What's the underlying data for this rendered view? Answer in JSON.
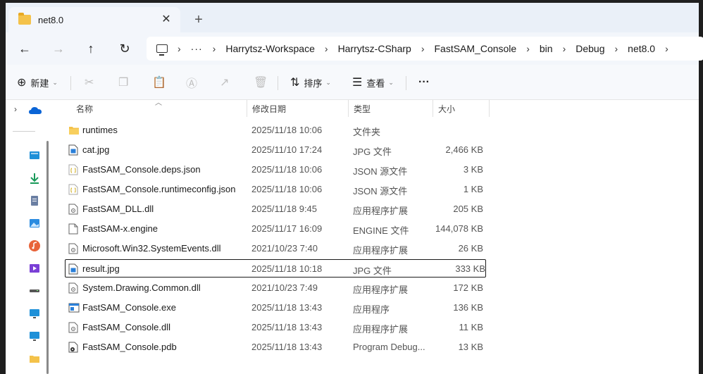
{
  "window": {
    "tab_title": "net8.0",
    "close_glyph": "✕",
    "new_tab_glyph": "+"
  },
  "nav": {
    "back_glyph": "←",
    "forward_glyph": "→",
    "up_glyph": "↑",
    "refresh_glyph": "↻",
    "overflow": "···",
    "breadcrumbs": [
      "Harrytsz-Workspace",
      "Harrytsz-CSharp",
      "FastSAM_Console",
      "bin",
      "Debug",
      "net8.0"
    ],
    "chevron": "›"
  },
  "toolbar": {
    "new_label": "新建",
    "sort_label": "排序",
    "view_label": "查看",
    "more_glyph": "···",
    "caret": "⌄"
  },
  "columns": {
    "name": "名称",
    "date": "修改日期",
    "type": "类型",
    "size": "大小"
  },
  "files": [
    {
      "name": "runtimes",
      "date": "2025/11/18 10:06",
      "type": "文件夹",
      "size": "",
      "icon": "folder-icon"
    },
    {
      "name": "cat.jpg",
      "date": "2025/11/10 17:24",
      "type": "JPG 文件",
      "size": "2,466 KB",
      "icon": "image-file-icon"
    },
    {
      "name": "FastSAM_Console.deps.json",
      "date": "2025/11/18 10:06",
      "type": "JSON 源文件",
      "size": "3 KB",
      "icon": "json-file-icon"
    },
    {
      "name": "FastSAM_Console.runtimeconfig.json",
      "date": "2025/11/18 10:06",
      "type": "JSON 源文件",
      "size": "1 KB",
      "icon": "json-file-icon"
    },
    {
      "name": "FastSAM_DLL.dll",
      "date": "2025/11/18 9:45",
      "type": "应用程序扩展",
      "size": "205 KB",
      "icon": "dll-file-icon"
    },
    {
      "name": "FastSAM-x.engine",
      "date": "2025/11/17 16:09",
      "type": "ENGINE 文件",
      "size": "144,078 KB",
      "icon": "blank-file-icon"
    },
    {
      "name": "Microsoft.Win32.SystemEvents.dll",
      "date": "2021/10/23 7:40",
      "type": "应用程序扩展",
      "size": "26 KB",
      "icon": "dll-file-icon"
    },
    {
      "name": "result.jpg",
      "date": "2025/11/18 10:18",
      "type": "JPG 文件",
      "size": "333 KB",
      "icon": "image-file-icon",
      "selected": true
    },
    {
      "name": "System.Drawing.Common.dll",
      "date": "2021/10/23 7:49",
      "type": "应用程序扩展",
      "size": "172 KB",
      "icon": "dll-file-icon"
    },
    {
      "name": "FastSAM_Console.exe",
      "date": "2025/11/18 13:43",
      "type": "应用程序",
      "size": "136 KB",
      "icon": "exe-file-icon"
    },
    {
      "name": "FastSAM_Console.dll",
      "date": "2025/11/18 13:43",
      "type": "应用程序扩展",
      "size": "11 KB",
      "icon": "dll-file-icon"
    },
    {
      "name": "FastSAM_Console.pdb",
      "date": "2025/11/18 13:43",
      "type": "Program Debug...",
      "size": "13 KB",
      "icon": "pdb-file-icon"
    }
  ],
  "colors": {
    "accent": "#0067c0",
    "folder": "#f4c24a",
    "selection_border": "#1a1a1a"
  }
}
